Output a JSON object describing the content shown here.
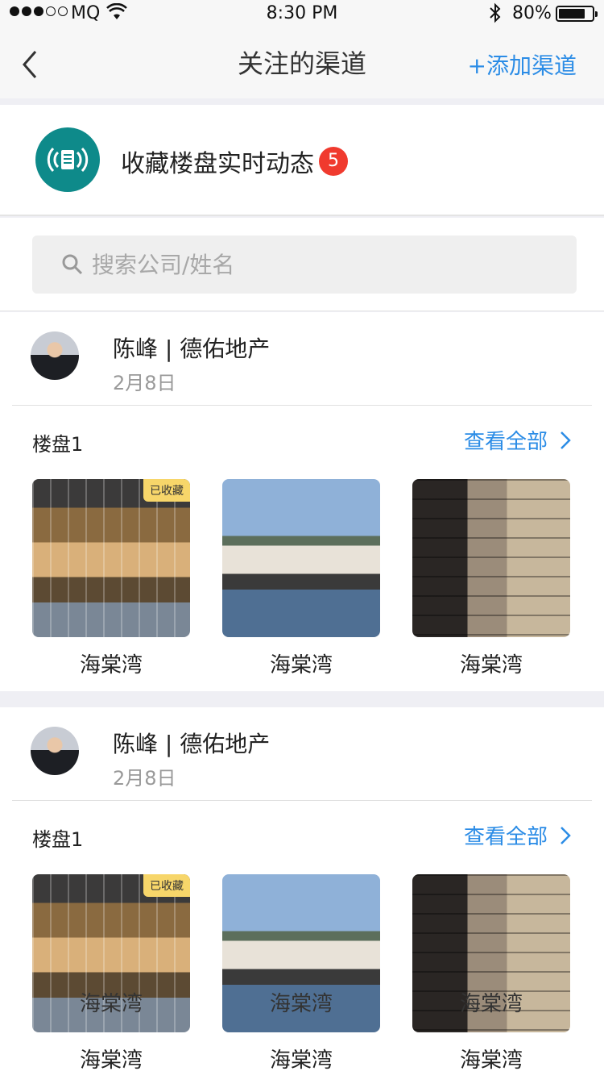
{
  "status_bar": {
    "carrier": "MQ",
    "time": "8:30 PM",
    "battery": "80%",
    "battery_level": 0.8
  },
  "nav": {
    "title": "关注的渠道",
    "add_label": "+添加渠道"
  },
  "follow": {
    "label": "收藏楼盘实时动态",
    "badge": "5"
  },
  "search": {
    "placeholder": "搜索公司/姓名"
  },
  "cards": [
    {
      "name": "陈峰 | 德佑地产",
      "date": "2月8日",
      "group": "楼盘1",
      "view_all": "查看全部",
      "items": [
        {
          "caption": "海棠湾",
          "tag": "已收藏"
        },
        {
          "caption": "海棠湾"
        },
        {
          "caption": "海棠湾"
        }
      ]
    },
    {
      "name": "陈峰 | 德佑地产",
      "date": "2月8日",
      "group": "楼盘1",
      "view_all": "查看全部",
      "items": [
        {
          "caption": "海棠湾",
          "tag": "已收藏",
          "overlay": "海棠湾"
        },
        {
          "caption": "海棠湾",
          "overlay": "海棠湾"
        },
        {
          "caption": "海棠湾",
          "overlay": "海棠湾"
        }
      ]
    }
  ],
  "colors": {
    "accent": "#2b8ce6",
    "badge": "#f03a2e",
    "icon_bg": "#0e8a8a",
    "tag_bg": "#f7d66a"
  }
}
